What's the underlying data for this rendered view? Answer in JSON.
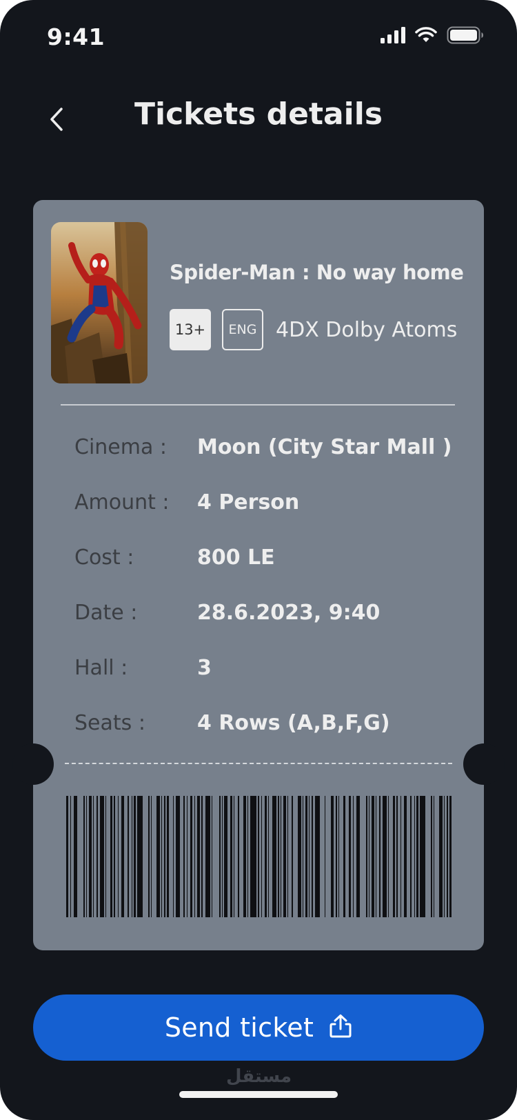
{
  "status_bar": {
    "time": "9:41"
  },
  "header": {
    "title": "Tickets details"
  },
  "movie": {
    "title": "Spider-Man : No way home",
    "age_rating": "13+",
    "language": "ENG",
    "format": "4DX Dolby Atoms"
  },
  "details": {
    "rows": [
      {
        "label": "Cinema :",
        "value": "Moon (City Star Mall )"
      },
      {
        "label": "Amount :",
        "value": "4 Person"
      },
      {
        "label": "Cost :",
        "value": "800 LE"
      },
      {
        "label": "Date :",
        "value": "28.6.2023, 9:40"
      },
      {
        "label": "Hall :",
        "value": "3"
      },
      {
        "label": "Seats :",
        "value": "4 Rows (A,B,F,G)"
      }
    ]
  },
  "action": {
    "send_label": "Send ticket"
  },
  "watermark": "مستقل",
  "colors": {
    "background": "#13161c",
    "card": "#77808c",
    "accent_button": "#1560d1",
    "label_text": "#3b3e43"
  },
  "icons": {
    "back": "chevron-left-icon",
    "signal": "cellular-signal-icon",
    "wifi": "wifi-icon",
    "battery": "battery-icon",
    "share": "share-upload-icon"
  }
}
